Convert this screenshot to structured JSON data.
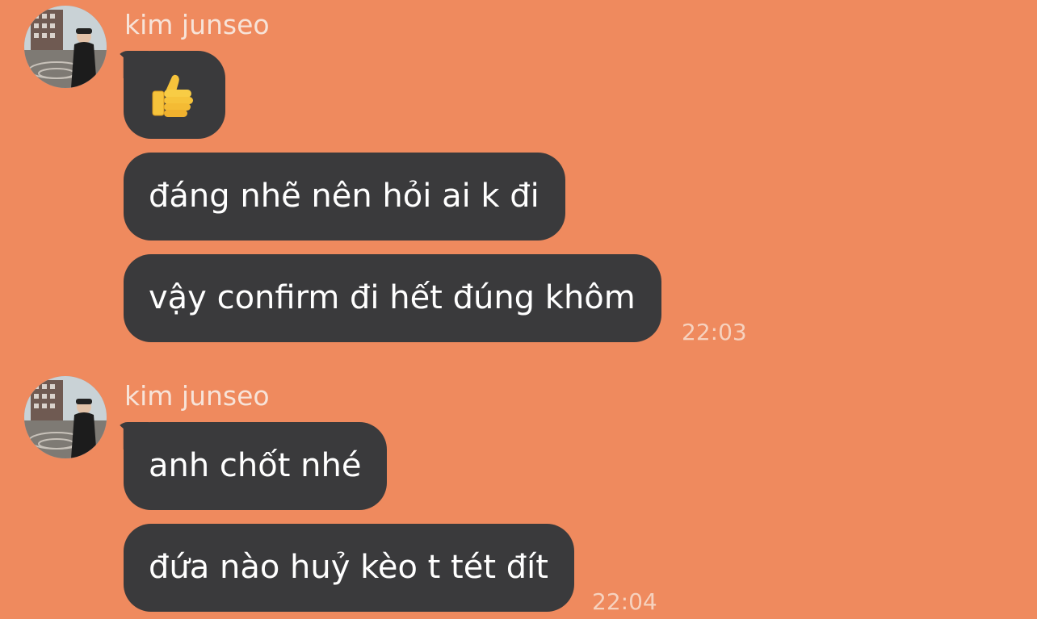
{
  "colors": {
    "background": "#EF8A5E",
    "bubble": "#3A3A3C",
    "bubble_text": "#FFFFFF",
    "sender_name": "#F7E3D8",
    "timestamp": "#F6D2BF"
  },
  "groups": [
    {
      "sender": "kim junseo",
      "avatar_icon": "user-photo-avatar",
      "messages": [
        {
          "type": "emoji",
          "icon": "thumbs-up-icon"
        },
        {
          "type": "text",
          "text": "đáng nhẽ nên hỏi ai k đi"
        },
        {
          "type": "text",
          "text": "vậy confirm đi hết đúng khôm"
        }
      ],
      "timestamp": "22:03"
    },
    {
      "sender": "kim junseo",
      "avatar_icon": "user-photo-avatar",
      "messages": [
        {
          "type": "text",
          "text": "anh chốt nhé"
        },
        {
          "type": "text",
          "text": "đứa nào huỷ kèo t tét đít"
        }
      ],
      "timestamp": "22:04"
    }
  ]
}
